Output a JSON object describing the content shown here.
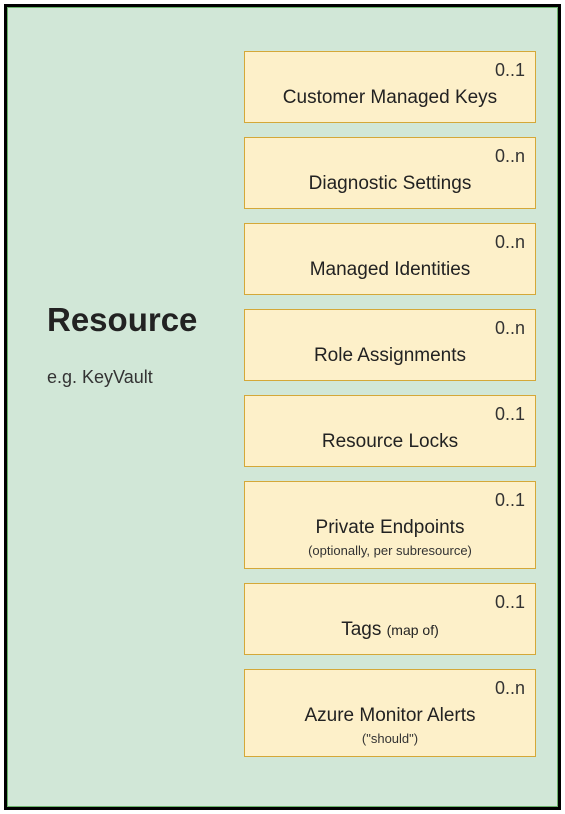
{
  "resource": {
    "title": "Resource",
    "subtitle": "e.g. KeyVault"
  },
  "items": {
    "0": {
      "cardinality": "0..1",
      "label": "Customer Managed Keys",
      "sublabel": ""
    },
    "1": {
      "cardinality": "0..n",
      "label": "Diagnostic Settings",
      "sublabel": ""
    },
    "2": {
      "cardinality": "0..n",
      "label": "Managed Identities",
      "sublabel": ""
    },
    "3": {
      "cardinality": "0..n",
      "label": "Role Assignments",
      "sublabel": ""
    },
    "4": {
      "cardinality": "0..1",
      "label": "Resource Locks",
      "sublabel": ""
    },
    "5": {
      "cardinality": "0..1",
      "label": "Private Endpoints",
      "sublabel": "(optionally, per subresource)"
    },
    "6": {
      "cardinality": "0..1",
      "label": "Tags ",
      "inline_sub": "(map of)"
    },
    "7": {
      "cardinality": "0..n",
      "label": "Azure Monitor Alerts",
      "sublabel": "(\"should\")"
    }
  }
}
